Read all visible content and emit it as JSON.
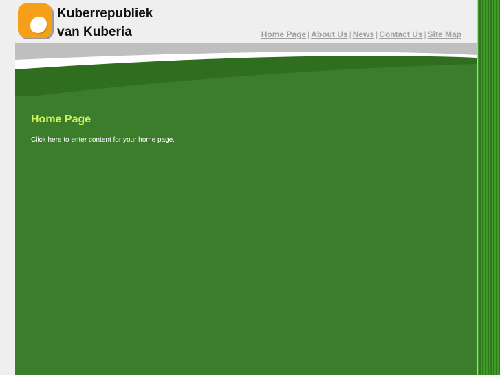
{
  "site": {
    "title_line1": "Kuberrepubliek",
    "title_line2": "van Kuberia"
  },
  "nav": {
    "items": [
      {
        "label": "Home Page"
      },
      {
        "label": "About Us"
      },
      {
        "label": "News"
      },
      {
        "label": "Contact Us"
      },
      {
        "label": "Site Map"
      }
    ],
    "separator": "|"
  },
  "main": {
    "heading": "Home Page",
    "body_text": "Click here to enter content for your home page."
  },
  "colors": {
    "logo_orange": "#f6a01a",
    "content_green": "#3c7d2b",
    "heading_lime": "#cdf25c",
    "nav_gray": "#a0a0a0"
  }
}
